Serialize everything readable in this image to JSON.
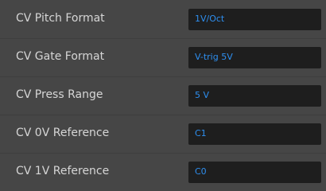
{
  "settings": {
    "rows": [
      {
        "label": "CV Pitch Format",
        "value": "1V/Oct"
      },
      {
        "label": "CV Gate Format",
        "value": "V-trig 5V"
      },
      {
        "label": "CV Press Range",
        "value": "5 V"
      },
      {
        "label": "CV 0V Reference",
        "value": "C1"
      },
      {
        "label": "CV 1V Reference",
        "value": "C0"
      }
    ]
  },
  "colors": {
    "panel_background": "#464646",
    "field_background": "#1e1e1e",
    "label_text": "#d6d6d6",
    "value_text": "#2e8ff0"
  }
}
